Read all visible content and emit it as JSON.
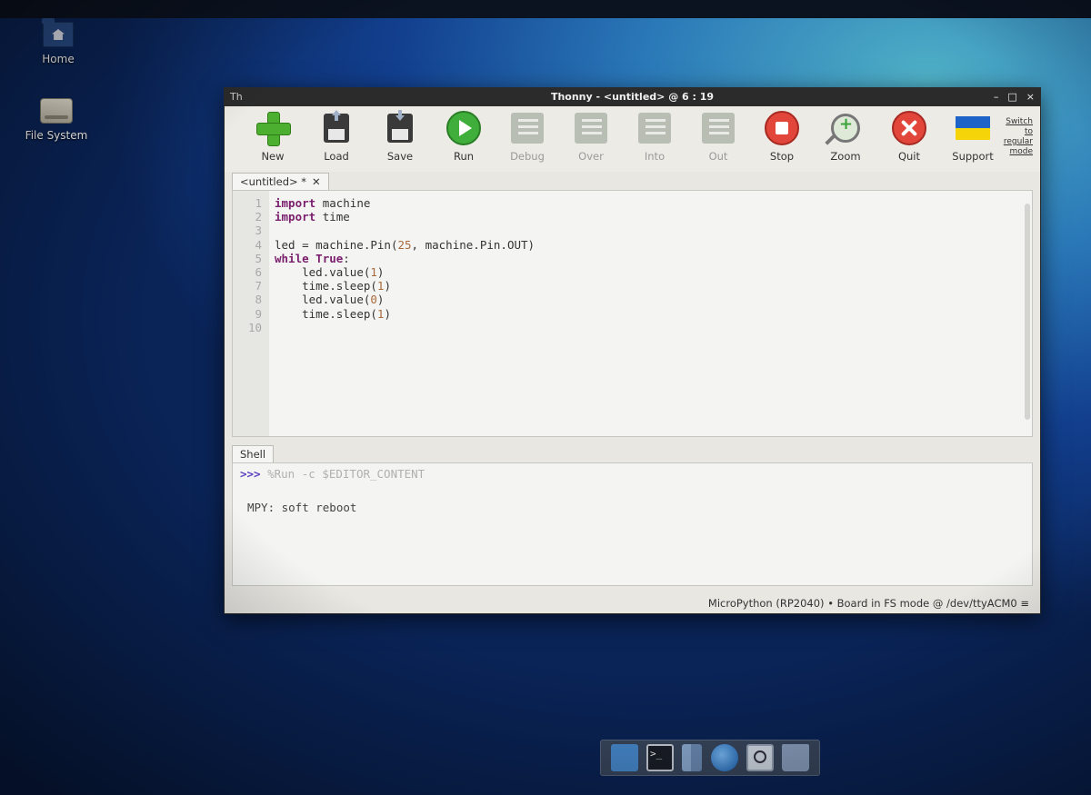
{
  "desktop": {
    "icons": [
      {
        "label": "Home"
      },
      {
        "label": "File System"
      }
    ]
  },
  "window": {
    "app_logo": "Th",
    "title": "Thonny  -  <untitled>  @  6 : 19",
    "controls": {
      "minimize": "–",
      "maximize": "□",
      "close": "×"
    }
  },
  "toolbar": {
    "items": [
      {
        "label": "New",
        "icon": "new-plus-icon",
        "enabled": true
      },
      {
        "label": "Load",
        "icon": "load-disk-icon",
        "enabled": true
      },
      {
        "label": "Save",
        "icon": "save-disk-icon",
        "enabled": true
      },
      {
        "label": "Run",
        "icon": "run-play-icon",
        "enabled": true
      },
      {
        "label": "Debug",
        "icon": "debug-icon",
        "enabled": false
      },
      {
        "label": "Over",
        "icon": "step-over-icon",
        "enabled": false
      },
      {
        "label": "Into",
        "icon": "step-into-icon",
        "enabled": false
      },
      {
        "label": "Out",
        "icon": "step-out-icon",
        "enabled": false
      },
      {
        "label": "Stop",
        "icon": "stop-icon",
        "enabled": true
      },
      {
        "label": "Zoom",
        "icon": "zoom-icon",
        "enabled": true
      },
      {
        "label": "Quit",
        "icon": "quit-icon",
        "enabled": true
      },
      {
        "label": "Support",
        "icon": "ukraine-flag-icon",
        "enabled": true
      }
    ],
    "switch_link": "Switch to regular mode"
  },
  "editor": {
    "tab_label": "<untitled> *",
    "tab_close": "✕",
    "line_numbers": [
      "1",
      "2",
      "3",
      "4",
      "5",
      "6",
      "7",
      "8",
      "9",
      "10"
    ],
    "lines": [
      "import machine",
      "import time",
      "",
      "led = machine.Pin(25, machine.Pin.OUT)",
      "while True:",
      "    led.value(1)",
      "    time.sleep(1)",
      "    led.value(0)",
      "    time.sleep(1)",
      ""
    ]
  },
  "shell": {
    "tab_label": "Shell",
    "prompt": ">>>",
    "command": "%Run -c $EDITOR_CONTENT",
    "output": "MPY: soft reboot"
  },
  "statusbar": {
    "text": "MicroPython (RP2040)  •  Board in FS mode @ /dev/ttyACM0  ≡"
  },
  "colors": {
    "keyword": "#7a1e6e",
    "number": "#a86a3c",
    "prompt": "#5a3fc2"
  },
  "dock": {
    "items": [
      "show-desktop-icon",
      "terminal-icon",
      "file-manager-icon",
      "web-browser-icon",
      "search-icon",
      "folder-icon"
    ]
  }
}
